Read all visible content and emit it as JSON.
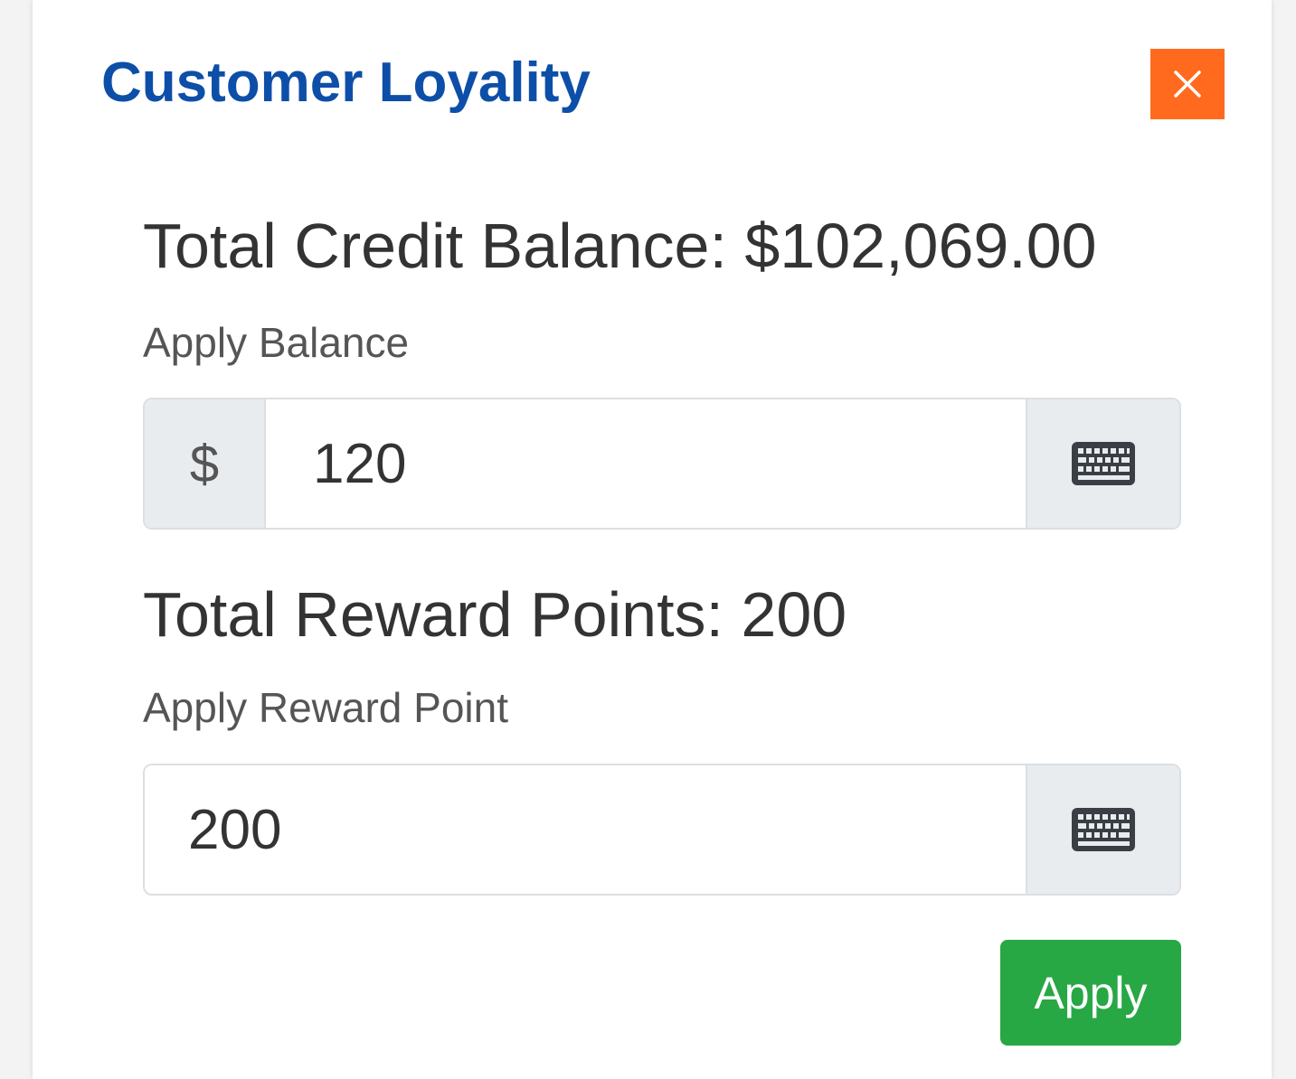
{
  "modal": {
    "title": "Customer Loyality",
    "close_symbol": "×"
  },
  "credit": {
    "heading": "Total Credit Balance: $102,069.00",
    "label": "Apply Balance",
    "prefix": "$",
    "value": "120",
    "keyboard_icon": "keyboard-icon"
  },
  "reward": {
    "heading": "Total Reward Points: 200",
    "label": "Apply Reward Point",
    "value": "200",
    "keyboard_icon": "keyboard-icon"
  },
  "actions": {
    "apply_label": "Apply"
  },
  "colors": {
    "title": "#0d4fa8",
    "close_bg": "#ff6a1f",
    "apply_bg": "#28a745"
  }
}
